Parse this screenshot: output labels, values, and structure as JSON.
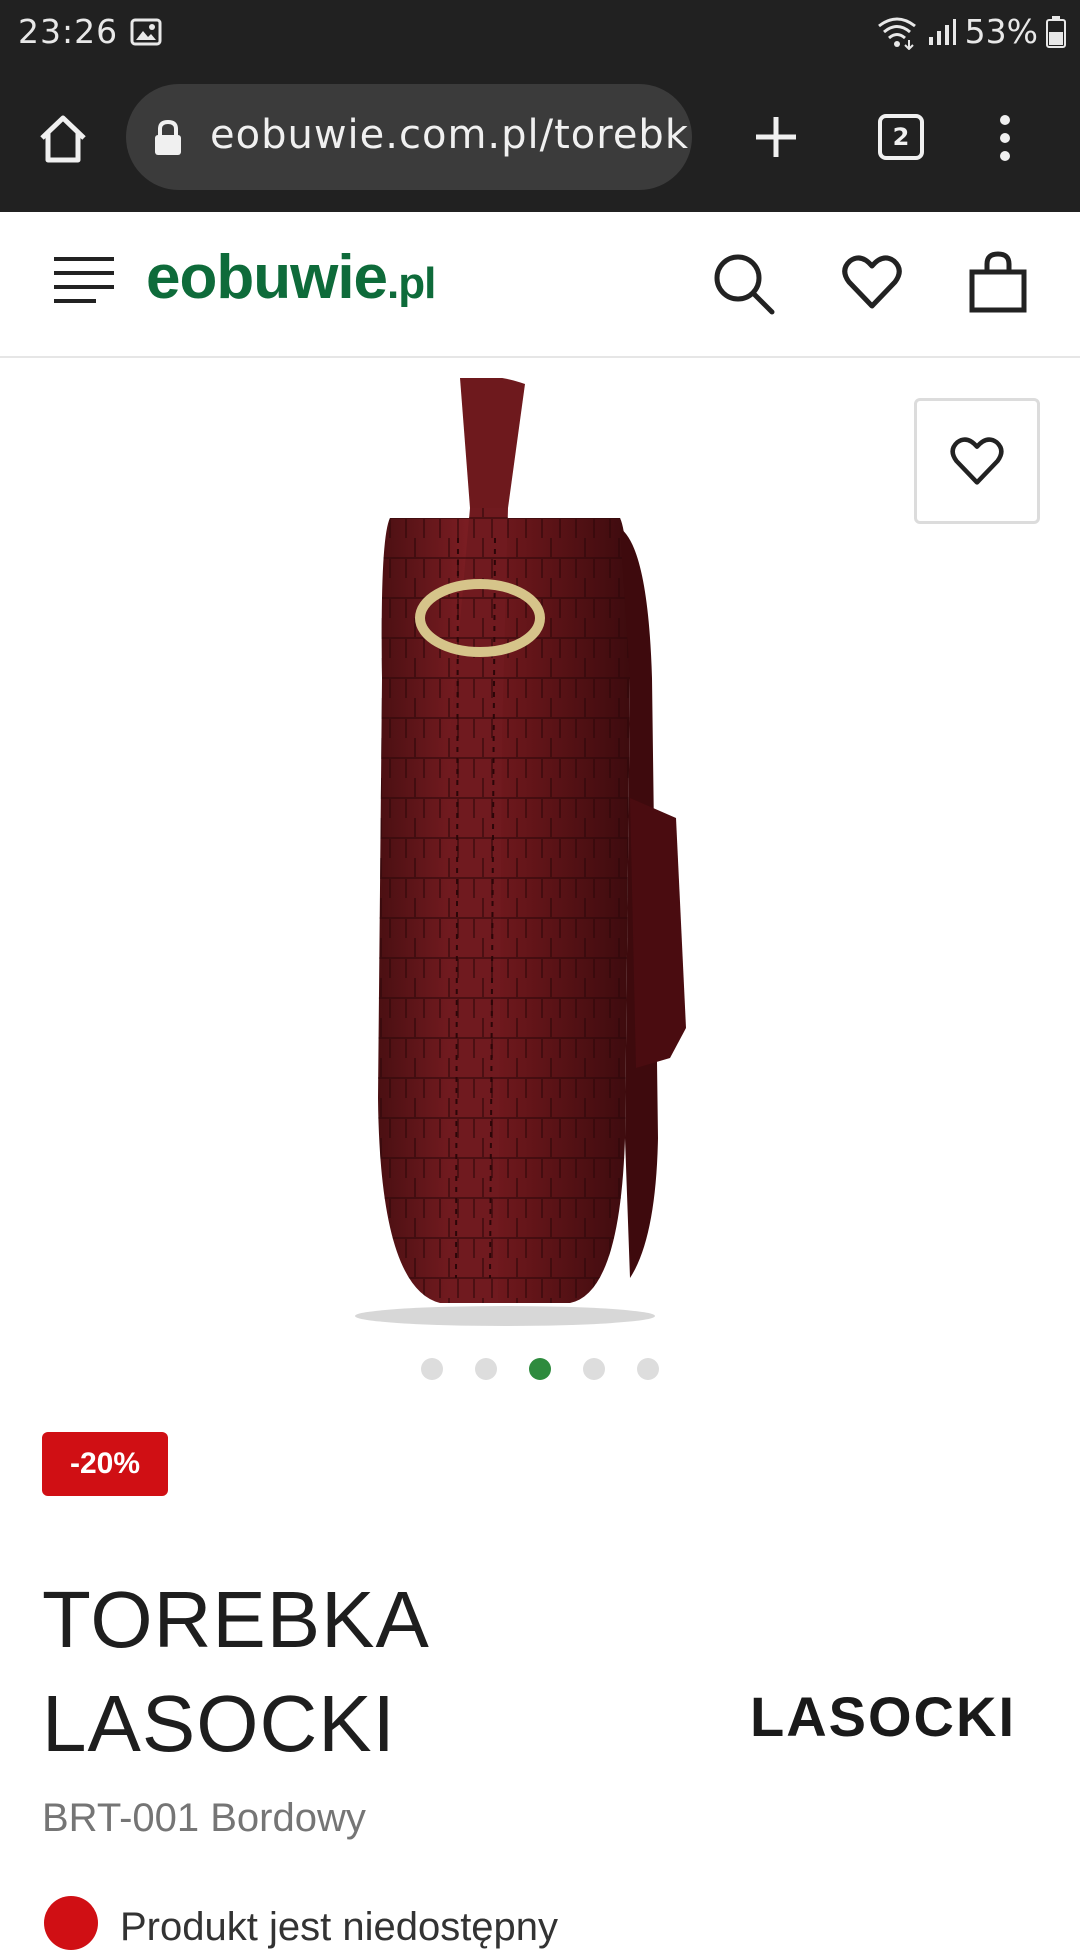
{
  "status_bar": {
    "time": "23:26",
    "battery": "53%",
    "icons": [
      "image-icon",
      "wifi-icon",
      "signal-icon",
      "battery-icon"
    ]
  },
  "browser": {
    "url": "eobuwie.com.pl/torebk",
    "tab_count": "2",
    "icons": [
      "home-icon",
      "lock-icon",
      "new-tab-icon",
      "more-icon"
    ]
  },
  "header": {
    "logo_main": "eobuwie",
    "logo_tld": ".pl",
    "brand_color": "#0e6b3a",
    "icons": [
      "menu-icon",
      "search-icon",
      "wishlist-icon",
      "cart-icon"
    ]
  },
  "gallery": {
    "image_count": 5,
    "active_index": 2,
    "active_dot_color": "#2e8b3e",
    "product_color": "#6b1a1c"
  },
  "product": {
    "discount": "-20%",
    "discount_color": "#d00f14",
    "title_line1": "TOREBKA",
    "title_line2": "LASOCKI",
    "brand": "LASOCKI",
    "sku": "BRT-001 Bordowy",
    "availability": "Produkt jest niedostępny"
  }
}
